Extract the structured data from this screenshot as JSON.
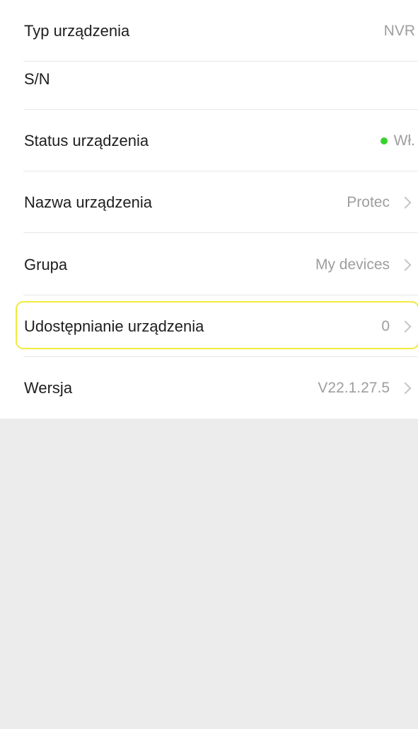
{
  "device_info": {
    "rows": [
      {
        "label": "Typ urządzenia",
        "value": "NVR"
      },
      {
        "label": "S/N",
        "value": ""
      },
      {
        "label": "Status urządzenia",
        "value": "Wł.",
        "status_color": "#39d12e"
      },
      {
        "label": "Nazwa urządzenia",
        "value": "Protec",
        "icon": "chevron-right-icon"
      },
      {
        "label": "Grupa",
        "value": "My devices",
        "icon": "chevron-right-icon"
      },
      {
        "label": "Udostępnianie urządzenia",
        "value": "0",
        "icon": "chevron-right-icon",
        "highlighted": true
      },
      {
        "label": "Wersja",
        "value": "V22.1.27.5",
        "icon": "chevron-right-icon"
      }
    ]
  }
}
